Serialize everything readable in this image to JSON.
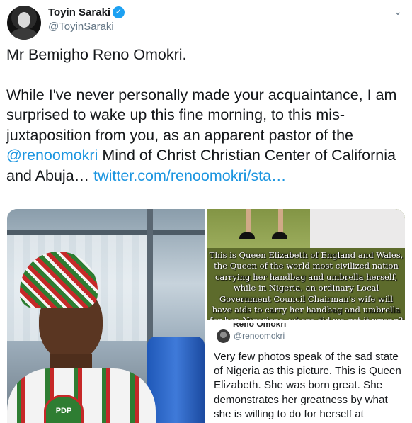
{
  "author": {
    "name": "Toyin Saraki",
    "handle": "@ToyinSaraki",
    "verified_glyph": "✓"
  },
  "menu_glyph": "⌄",
  "tweet": {
    "line1": "Mr Bemigho Reno Omokri.",
    "body_before_mention": "While I've never personally made your acquaintance, I am surprised to wake up this fine morning, to this mis-juxtaposition from you, as an apparent pastor of the ",
    "mention": "@renoomokri",
    "body_after_mention": " Mind of Christ Christian Center of California and Abuja… ",
    "link": "twitter.com/renoomokri/sta…"
  },
  "media": {
    "left_photo": {
      "badge_text": "PDP"
    },
    "meme": {
      "text": "This is Queen Elizabeth of England and Wales, the Queen of the world most civilized nation carrying her handbag and umbrella herself, while in Nigeria, an ordinary Local Government Council Chairman's wife will have aids to carry her handbag and umbrella for her. Nigerians, where did we get it wrong?"
    },
    "screenshot": {
      "cut_name": "Reno Omokri",
      "handle": "@renoomokri",
      "text": "Very few photos speak of the sad state of Nigeria as this picture. This is Queen Elizabeth. She was born great. She demonstrates her greatness by what she is willing to do for herself at"
    }
  },
  "icons": {
    "avatar": "profile-photo",
    "verified": "verified-badge-icon",
    "menu": "chevron-down-icon"
  },
  "colors": {
    "link": "#1b95e0",
    "verified": "#1da1f2",
    "secondary_text": "#657786"
  }
}
